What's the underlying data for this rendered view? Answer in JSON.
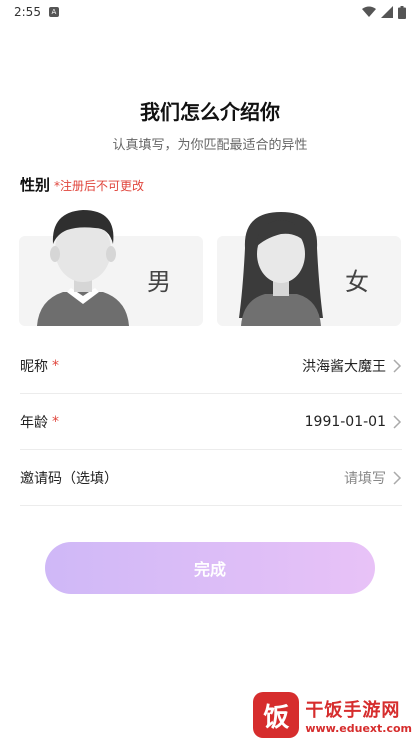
{
  "status_bar": {
    "time": "2:55",
    "notification_glyph": "A"
  },
  "header": {
    "title": "我们怎么介绍你",
    "subtitle": "认真填写，为你匹配最适合的异性"
  },
  "gender": {
    "label": "性别",
    "note": "*注册后不可更改",
    "options": [
      {
        "label": "男"
      },
      {
        "label": "女"
      }
    ]
  },
  "form": {
    "nickname": {
      "label": "昵称",
      "required_mark": "*",
      "value": "洪海酱大魔王"
    },
    "age": {
      "label": "年龄",
      "required_mark": "*",
      "value": "1991-01-01"
    },
    "invite": {
      "label": "邀请码（选填）",
      "placeholder": "请填写"
    }
  },
  "finish_button": {
    "label": "完成"
  },
  "watermark": {
    "logo_char": "饭",
    "title": "干饭手游网",
    "url": "www.eduext.com"
  },
  "colors": {
    "accent_start": "#cfb8f7",
    "accent_end": "#e8c2f7",
    "required": "#e0463d",
    "watermark": "#d62d2d"
  },
  "icons": [
    "wifi-icon",
    "signal-icon",
    "battery-icon",
    "chevron-right-icon"
  ]
}
